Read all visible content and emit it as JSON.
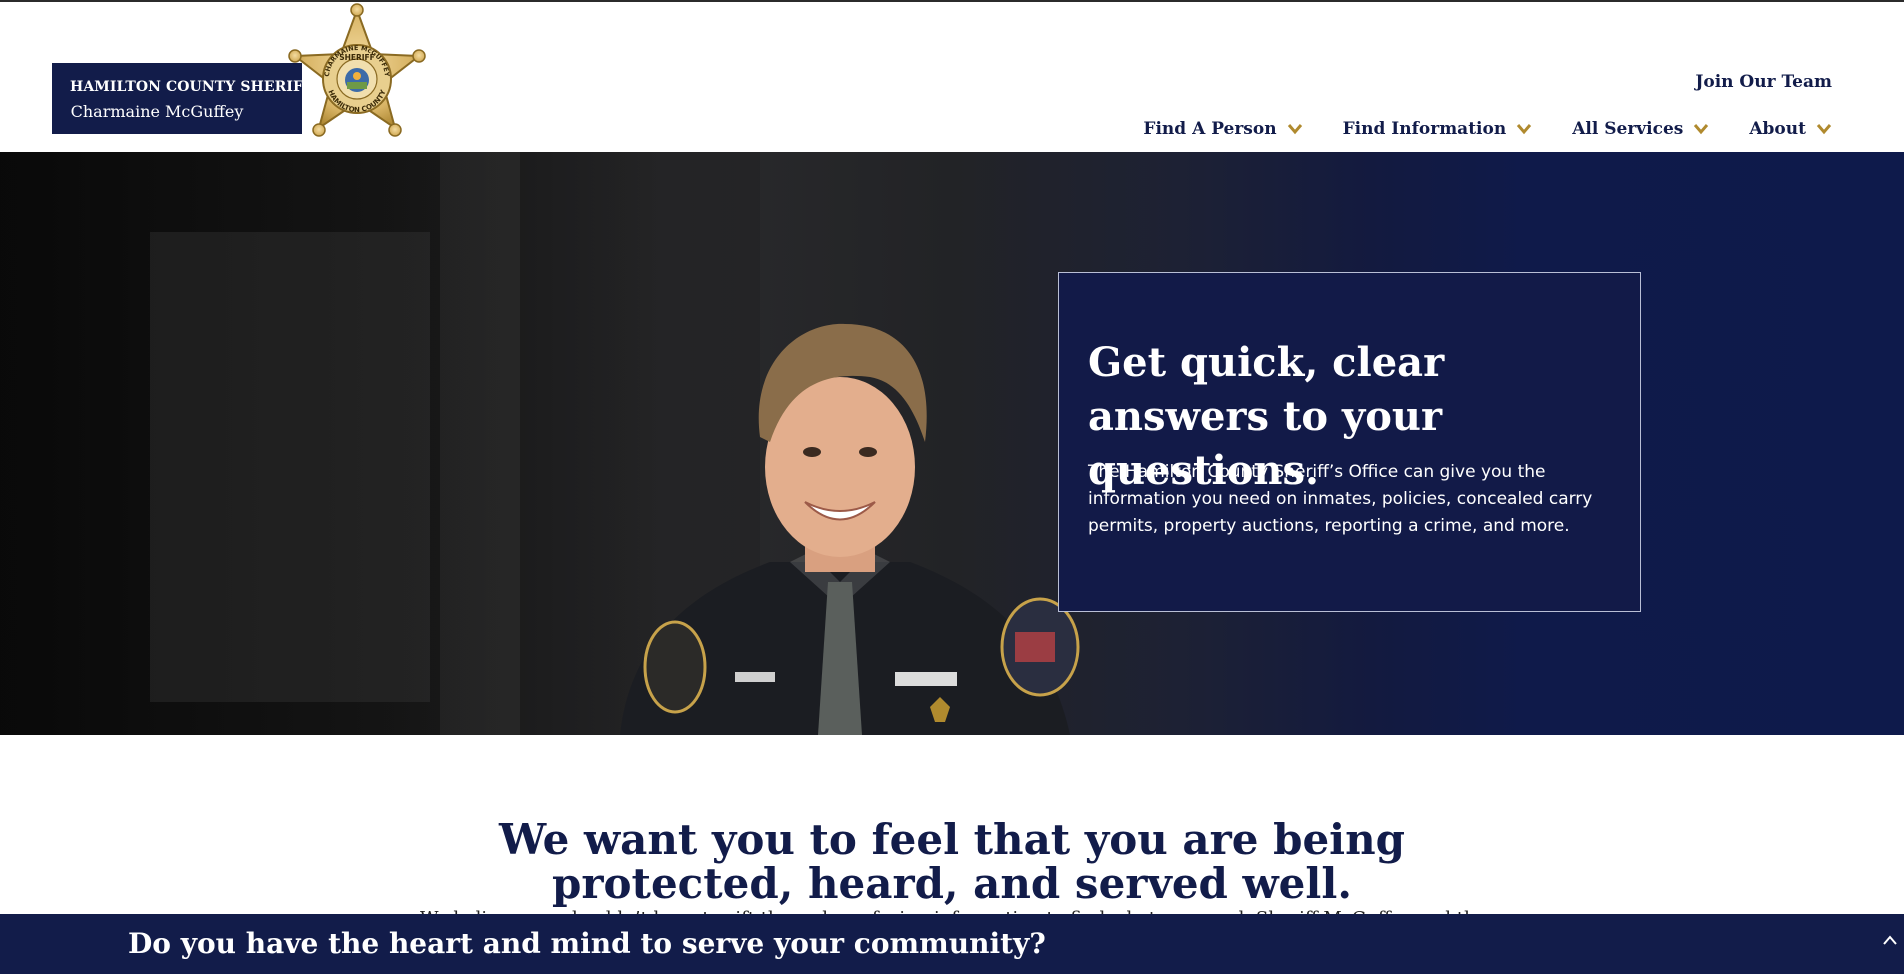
{
  "header": {
    "brand_line1": "HAMILTON COUNTY SHERIFF",
    "brand_line2": "Charmaine McGuffey",
    "badge": {
      "top_text": "CHARMAINE McGUFFEY",
      "center_text": "SHERIFF",
      "bottom_text": "HAMILTON COUNTY",
      "icon": "sheriff-star-badge"
    },
    "join_label": "Join Our Team",
    "nav": [
      {
        "label": "Find A Person",
        "icon": "chevron-down-icon"
      },
      {
        "label": "Find Information",
        "icon": "chevron-down-icon"
      },
      {
        "label": "All Services",
        "icon": "chevron-down-icon"
      },
      {
        "label": "About",
        "icon": "chevron-down-icon"
      }
    ]
  },
  "hero": {
    "title": "Get quick, clear answers to your questions.",
    "body": "The Hamilton County Sheriff’s Office can give you the information you need on inmates, policies, concealed carry permits, property auctions, reporting a crime, and more."
  },
  "mission": {
    "heading": "We want you to feel that you are being protected, heard, and served well.",
    "text": "We believe you shouldn’t have to sift through confusing information to find what you need. Sheriff McGuffey and the"
  },
  "banner": {
    "text": "Do you have the heart and mind to serve your community?",
    "icon": "chevron-up-icon"
  },
  "colors": {
    "navy": "#121c4a",
    "gold": "#b08a2e",
    "white": "#ffffff"
  }
}
